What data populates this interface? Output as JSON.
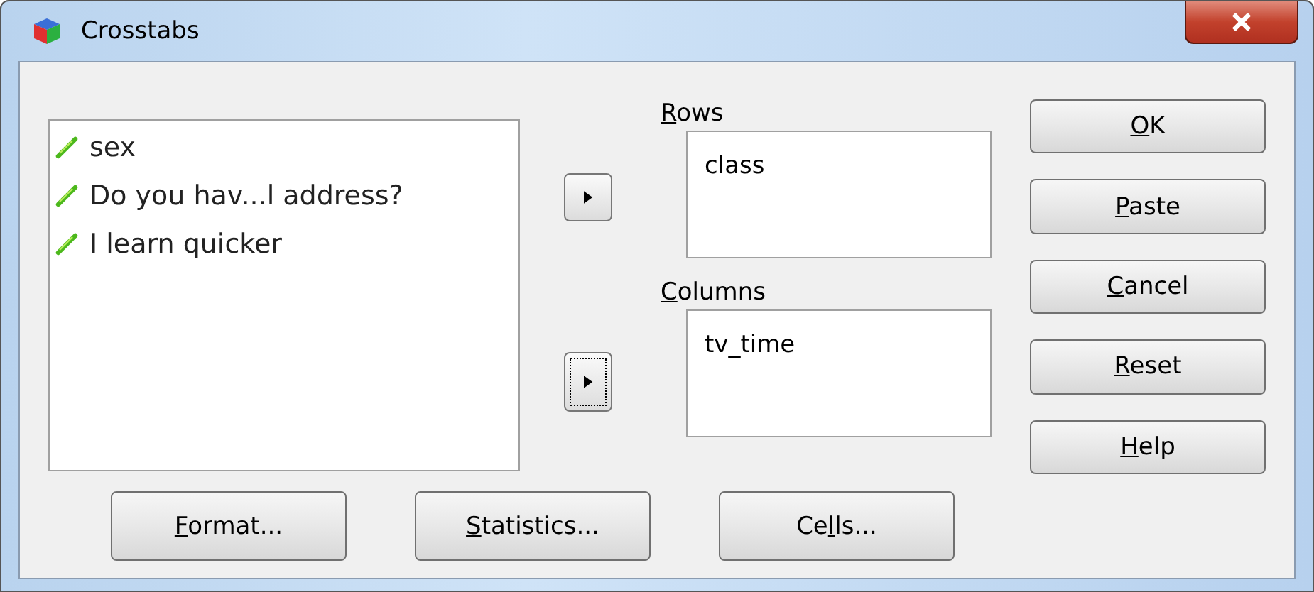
{
  "window": {
    "title": "Crosstabs"
  },
  "variables": [
    {
      "label": "sex"
    },
    {
      "label": "Do you hav...l address?"
    },
    {
      "label": "I learn quicker"
    }
  ],
  "move_buttons": [
    {
      "focused": false
    },
    {
      "focused": true
    }
  ],
  "targets": [
    {
      "key": "R",
      "after": "ows",
      "items": [
        "class"
      ]
    },
    {
      "key": "C",
      "after": "olumns",
      "items": [
        "tv_time"
      ]
    }
  ],
  "side_buttons": [
    {
      "key": "O",
      "after": "K"
    },
    {
      "key": "P",
      "after": "aste"
    },
    {
      "key": "C",
      "after": "ancel"
    },
    {
      "key": "R",
      "after": "eset"
    },
    {
      "key": "H",
      "after": "elp"
    }
  ],
  "bottom_buttons": [
    {
      "key": "F",
      "after": "ormat..."
    },
    {
      "key": "S",
      "after": "tatistics..."
    },
    {
      "before": "Ce",
      "key": "l",
      "after": "ls..."
    }
  ]
}
